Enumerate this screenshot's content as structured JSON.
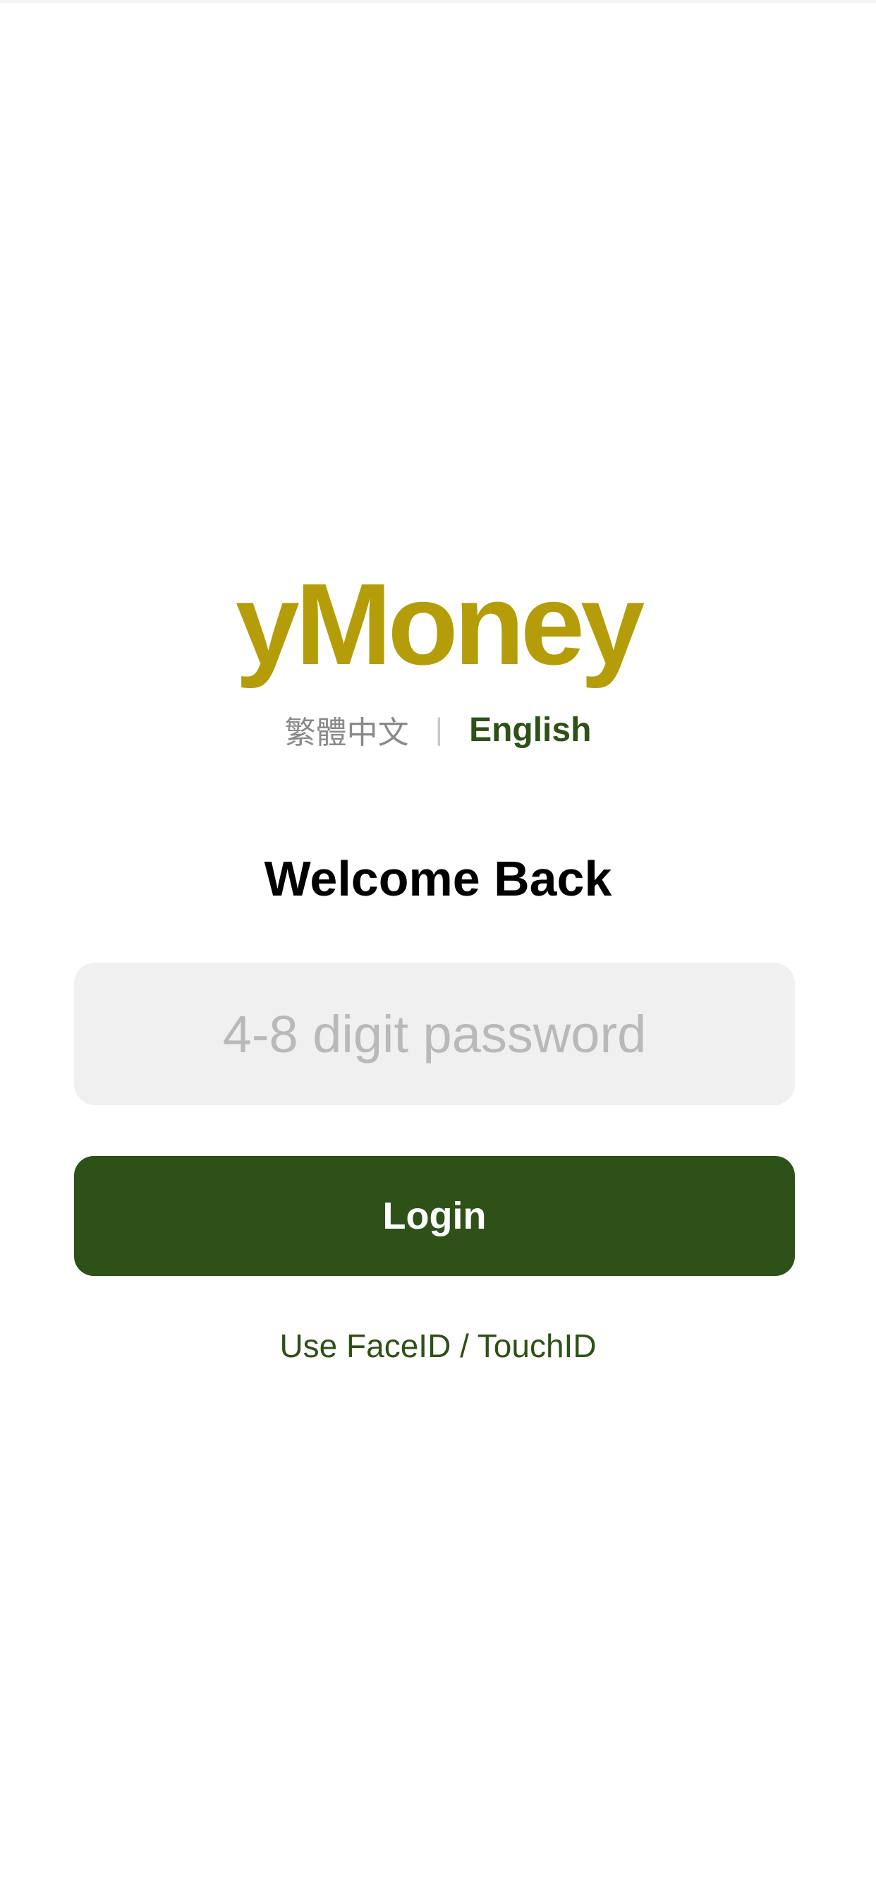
{
  "brand": {
    "name": "yMoney",
    "color": "#b59d0a"
  },
  "language": {
    "chinese_label": "繁體中文",
    "separator": "|",
    "english_label": "English",
    "selected": "English"
  },
  "login": {
    "heading": "Welcome Back",
    "password_placeholder": "4-8 digit password",
    "password_value": "",
    "login_button_label": "Login",
    "biometric_link_label": "Use FaceID / TouchID"
  },
  "colors": {
    "primary_green": "#2e5117",
    "field_background": "#f0f0f0",
    "placeholder_gray": "#b9b9b9"
  }
}
